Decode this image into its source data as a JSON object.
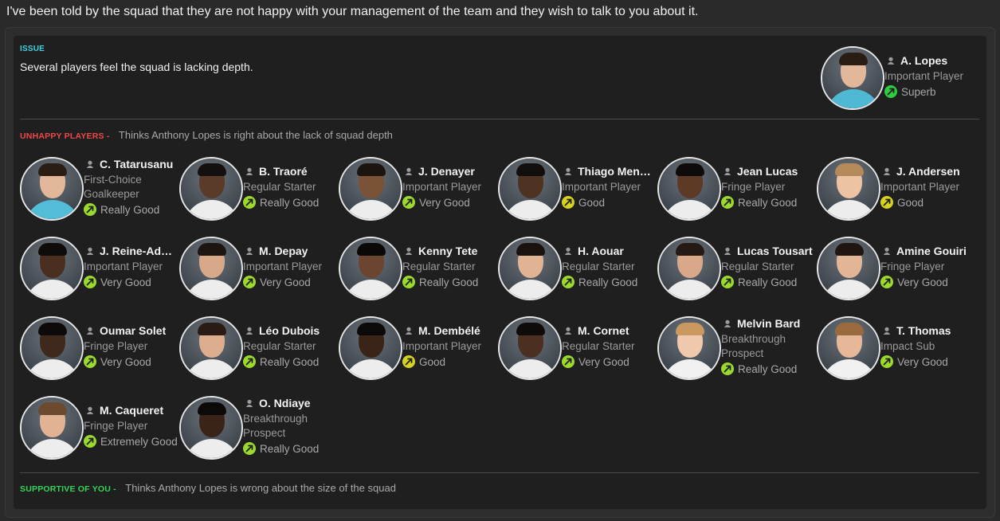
{
  "headline": "I've been told by the squad that they are not happy with your management of the team and they wish to talk to you about it.",
  "issue": {
    "tag": "ISSUE",
    "text": "Several players feel the squad is lacking depth.",
    "player": {
      "name": "A. Lopes",
      "role": "Important Player",
      "rating": "Superb",
      "rating_color": "#2ecc40"
    }
  },
  "unhappy": {
    "tag": "UNHAPPY PLAYERS -",
    "desc": "Thinks Anthony Lopes is right about the lack of squad depth",
    "players": [
      {
        "name": "C. Tatarusanu",
        "role": "First-Choice Goalkeeper",
        "rating": "Really Good",
        "rating_color": "#9bd92c"
      },
      {
        "name": "B. Traoré",
        "role": "Regular Starter",
        "rating": "Really Good",
        "rating_color": "#9bd92c"
      },
      {
        "name": "J. Denayer",
        "role": "Important Player",
        "rating": "Very Good",
        "rating_color": "#9bd92c"
      },
      {
        "name": "Thiago Mendes",
        "role": "Important Player",
        "rating": "Good",
        "rating_color": "#d4d21e"
      },
      {
        "name": "Jean Lucas",
        "role": "Fringe Player",
        "rating": "Really Good",
        "rating_color": "#9bd92c"
      },
      {
        "name": "J. Andersen",
        "role": "Important Player",
        "rating": "Good",
        "rating_color": "#d4d21e"
      },
      {
        "name": "J. Reine-Adélaïde",
        "role": "Important Player",
        "rating": "Very Good",
        "rating_color": "#9bd92c"
      },
      {
        "name": "M. Depay",
        "role": "Important Player",
        "rating": "Very Good",
        "rating_color": "#9bd92c"
      },
      {
        "name": "Kenny Tete",
        "role": "Regular Starter",
        "rating": "Really Good",
        "rating_color": "#9bd92c"
      },
      {
        "name": "H. Aouar",
        "role": "Regular Starter",
        "rating": "Really Good",
        "rating_color": "#9bd92c"
      },
      {
        "name": "Lucas Tousart",
        "role": "Regular Starter",
        "rating": "Really Good",
        "rating_color": "#9bd92c"
      },
      {
        "name": "Amine Gouiri",
        "role": "Fringe Player",
        "rating": "Very Good",
        "rating_color": "#9bd92c"
      },
      {
        "name": "Oumar Solet",
        "role": "Fringe Player",
        "rating": "Very Good",
        "rating_color": "#9bd92c"
      },
      {
        "name": "Léo Dubois",
        "role": "Regular Starter",
        "rating": "Really Good",
        "rating_color": "#9bd92c"
      },
      {
        "name": "M. Dembélé",
        "role": "Important Player",
        "rating": "Good",
        "rating_color": "#d4d21e"
      },
      {
        "name": "M. Cornet",
        "role": "Regular Starter",
        "rating": "Very Good",
        "rating_color": "#9bd92c"
      },
      {
        "name": "Melvin Bard",
        "role": "Breakthrough Prospect",
        "rating": "Really Good",
        "rating_color": "#9bd92c"
      },
      {
        "name": "T. Thomas",
        "role": "Impact Sub",
        "rating": "Very Good",
        "rating_color": "#9bd92c"
      },
      {
        "name": "M. Caqueret",
        "role": "Fringe Player",
        "rating": "Extremely Good",
        "rating_color": "#9bd92c"
      },
      {
        "name": "O. Ndiaye",
        "role": "Breakthrough Prospect",
        "rating": "Really Good",
        "rating_color": "#9bd92c"
      }
    ]
  },
  "supportive": {
    "tag": "SUPPORTIVE OF YOU -",
    "desc": "Thinks Anthony Lopes is wrong about the size of the squad"
  }
}
